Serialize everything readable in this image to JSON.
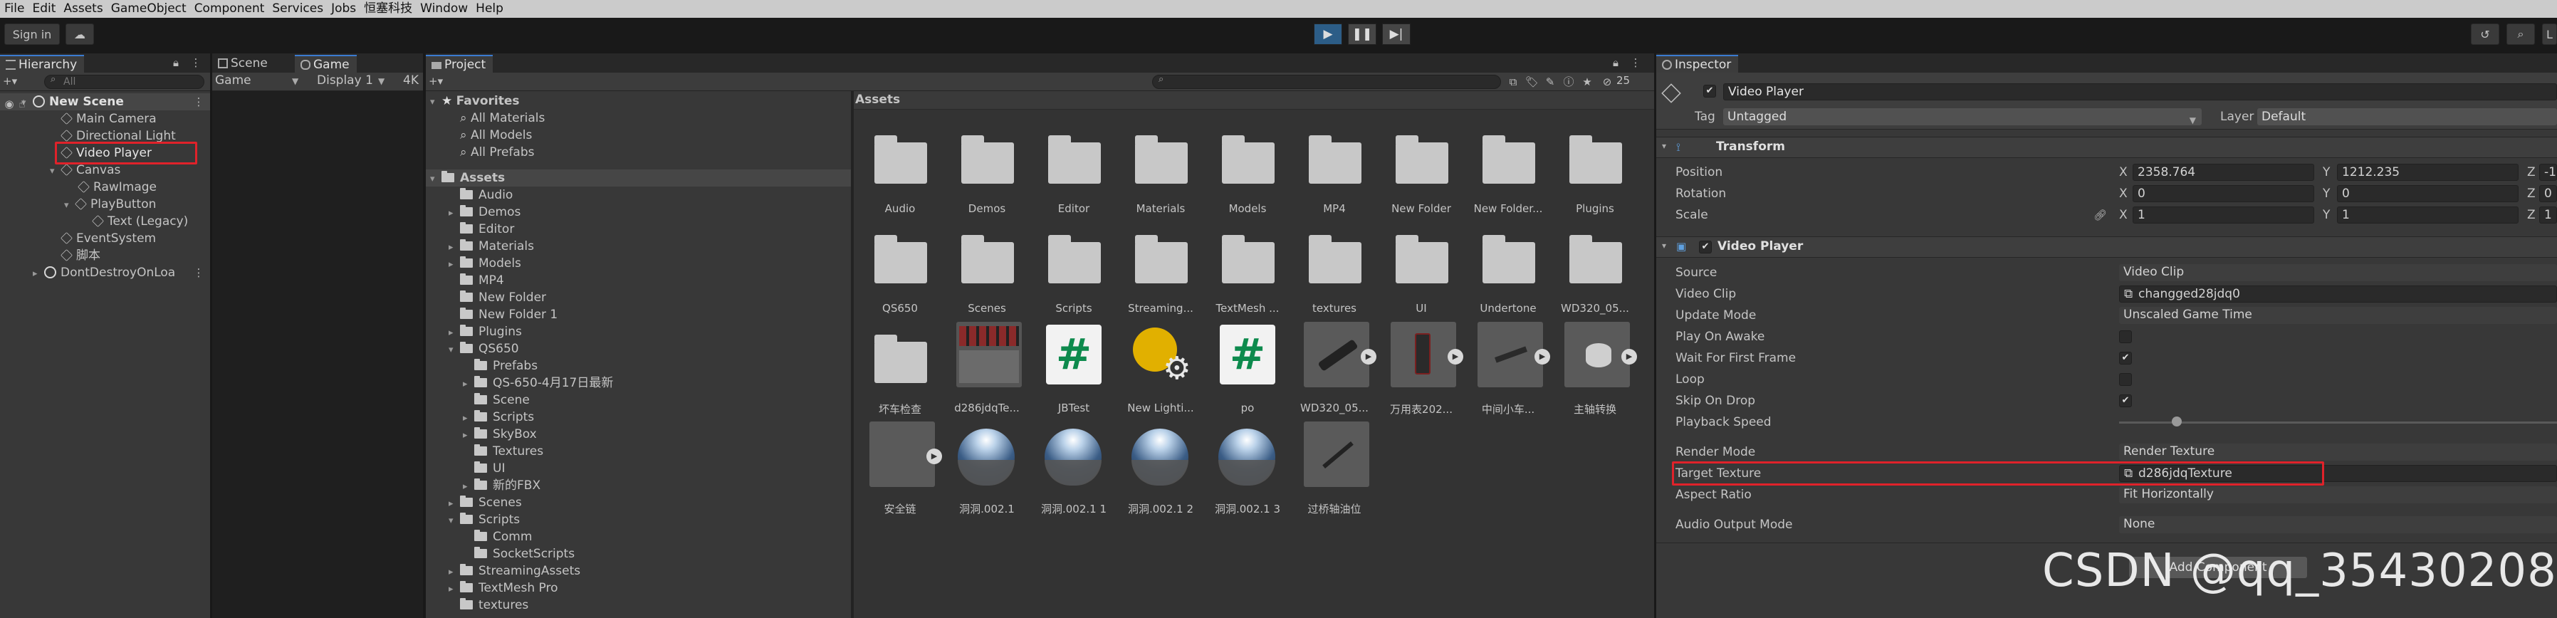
{
  "menu": [
    "File",
    "Edit",
    "Assets",
    "GameObject",
    "Component",
    "Services",
    "Jobs",
    "恒塞科技",
    "Window",
    "Help"
  ],
  "toolbar": {
    "sign_in": "Sign in"
  },
  "hierarchy": {
    "tab": "Hierarchy",
    "search_placeholder": "All",
    "items": [
      {
        "label": "New Scene"
      },
      {
        "label": "Main Camera"
      },
      {
        "label": "Directional Light"
      },
      {
        "label": "Video Player"
      },
      {
        "label": "Canvas"
      },
      {
        "label": "RawImage"
      },
      {
        "label": "PlayButton"
      },
      {
        "label": "Text (Legacy)"
      },
      {
        "label": "EventSystem"
      },
      {
        "label": "脚本"
      },
      {
        "label": "DontDestroyOnLoa"
      }
    ]
  },
  "scene_game": {
    "tabs": [
      "Scene",
      "Game"
    ],
    "game_dropdown": "Game",
    "display_dropdown": "Display 1",
    "resolution": "4K"
  },
  "project": {
    "tab": "Project",
    "hidden_count": "25",
    "favorites_label": "Favorites",
    "favorites": [
      "All Materials",
      "All Models",
      "All Prefabs"
    ],
    "tree": [
      "Assets",
      "Audio",
      "Demos",
      "Editor",
      "Materials",
      "Models",
      "MP4",
      "New Folder",
      "New Folder 1",
      "Plugins",
      "QS650",
      "Prefabs",
      "QS-650-4月17日最新",
      "Scene",
      "Scripts",
      "SkyBox",
      "Textures",
      "UI",
      "新的FBX",
      "Scenes",
      "Scripts",
      "Comm",
      "SocketScripts",
      "StreamingAssets",
      "TextMesh Pro",
      "textures"
    ],
    "breadcrumb": "Assets",
    "assets_row1": [
      "Audio",
      "Demos",
      "Editor",
      "Materials",
      "Models",
      "MP4",
      "New Folder",
      "New Folder...",
      "Plugins"
    ],
    "assets_row2": [
      "QS650",
      "Scenes",
      "Scripts",
      "Streaming...",
      "TextMesh ...",
      "textures",
      "UI",
      "Undertone",
      "WD320_05..."
    ],
    "assets_row3": [
      "坏车检查",
      "d286jdqTe...",
      "JBTest",
      "New Lighti...",
      "po",
      "WD320_05...",
      "万用表202...",
      "中间小车...",
      "主轴转换"
    ],
    "assets_row4": [
      "安全链",
      "洞洞.002.1",
      "洞洞.002.1 1",
      "洞洞.002.1 2",
      "洞洞.002.1 3",
      "过桥轴油位"
    ]
  },
  "inspector": {
    "tab": "Inspector",
    "object_name": "Video Player",
    "tag_label": "Tag",
    "tag_value": "Untagged",
    "layer_label": "Layer",
    "layer_value": "Default",
    "transform": {
      "title": "Transform",
      "position_label": "Position",
      "rotation_label": "Rotation",
      "scale_label": "Scale",
      "position": {
        "x": "2358.764",
        "y": "1212.235",
        "z": "-1"
      },
      "rotation": {
        "x": "0",
        "y": "0",
        "z": "0"
      },
      "scale": {
        "x": "1",
        "y": "1",
        "z": "1"
      }
    },
    "video_player": {
      "title": "Video Player",
      "fields": [
        {
          "label": "Source",
          "value": "Video Clip"
        },
        {
          "label": "Video Clip",
          "value": "changged28jdq0"
        },
        {
          "label": "Update Mode",
          "value": "Unscaled Game Time"
        },
        {
          "label": "Play On Awake",
          "checked": false
        },
        {
          "label": "Wait For First Frame",
          "checked": true
        },
        {
          "label": "Loop",
          "checked": false
        },
        {
          "label": "Skip On Drop",
          "checked": true
        },
        {
          "label": "Playback Speed",
          "value": ""
        },
        {
          "label": "Render Mode",
          "value": "Render Texture"
        },
        {
          "label": "Target Texture",
          "value": "d286jdqTexture"
        },
        {
          "label": "Aspect Ratio",
          "value": "Fit Horizontally"
        },
        {
          "label": "Audio Output Mode",
          "value": "None"
        }
      ],
      "playback_speed": 1
    },
    "add_component": "Add Component"
  },
  "watermark": "CSDN @qq_35430208",
  "colors": {
    "accent": "#3b7bd0",
    "highlight": "#e0222a",
    "selection": "#2c5d87"
  }
}
